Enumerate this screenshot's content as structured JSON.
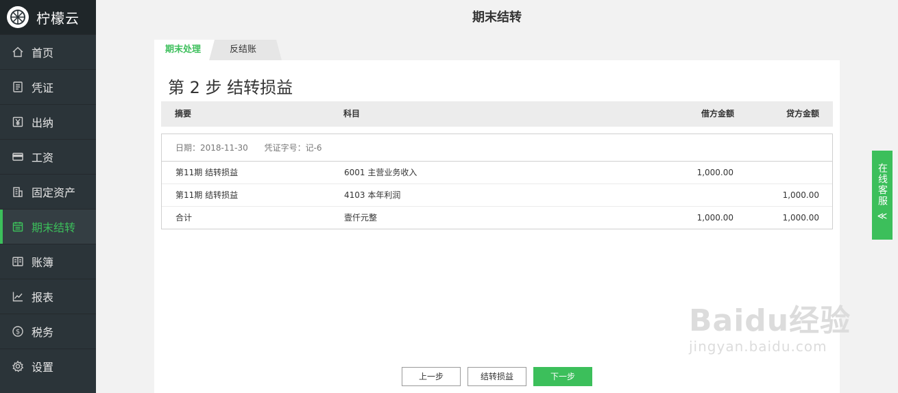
{
  "app": {
    "name": "柠檬云"
  },
  "sidebar": {
    "items": [
      {
        "label": "首页",
        "icon": "home-icon"
      },
      {
        "label": "凭证",
        "icon": "voucher-icon"
      },
      {
        "label": "出纳",
        "icon": "cashier-icon"
      },
      {
        "label": "工资",
        "icon": "salary-card-icon"
      },
      {
        "label": "固定资产",
        "icon": "building-icon"
      },
      {
        "label": "期末结转",
        "icon": "calendar-icon",
        "active": true
      },
      {
        "label": "账簿",
        "icon": "book-icon"
      },
      {
        "label": "报表",
        "icon": "chart-icon"
      },
      {
        "label": "税务",
        "icon": "dollar-icon"
      },
      {
        "label": "设置",
        "icon": "gear-icon"
      }
    ]
  },
  "header": {
    "title": "期末结转"
  },
  "tabs": [
    {
      "label": "期末处理",
      "active": true
    },
    {
      "label": "反结账",
      "active": false
    }
  ],
  "main": {
    "step_title": "第 2 步 结转损益",
    "table_headers": {
      "summary": "摘要",
      "subject": "科目",
      "debit": "借方金额",
      "credit": "贷方金额"
    },
    "voucher": {
      "date_label": "日期：2018-11-30",
      "number_label": "凭证字号：记-6",
      "rows": [
        {
          "summary": "第11期 结转损益",
          "subject": "6001 主营业务收入",
          "debit": "1,000.00",
          "credit": ""
        },
        {
          "summary": "第11期 结转损益",
          "subject": "4103 本年利润",
          "debit": "",
          "credit": "1,000.00"
        },
        {
          "summary": "合计",
          "subject": "壹仟元整",
          "debit": "1,000.00",
          "credit": "1,000.00"
        }
      ]
    }
  },
  "buttons": {
    "prev": "上一步",
    "transfer": "结转损益",
    "next": "下一步"
  },
  "service": {
    "label": "在线客服",
    "arrow": "≪"
  },
  "watermark": {
    "main": "Baidu经验",
    "sub": "jingyan.baidu.com"
  },
  "colors": {
    "accent": "#3cbf5b",
    "sidebar_bg": "#2b3439",
    "logo_bg": "#1f2629"
  }
}
